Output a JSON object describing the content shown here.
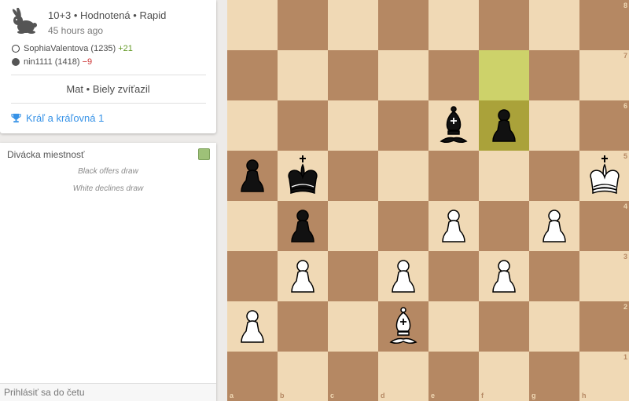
{
  "game": {
    "setup": "10+3 • Hodnotená • Rapid",
    "time_ago": "45 hours ago",
    "white_player": "SophiaValentova (1235)",
    "white_diff": "+21",
    "black_player": "nin1111 (1418)",
    "black_diff": "−9",
    "status": "Mat • Biely zvíťazil",
    "tournament": "Kráľ a kráľovná 1"
  },
  "chat": {
    "title": "Divácka miestnosť",
    "lines": [
      "Black offers draw",
      "White declines draw"
    ],
    "input_placeholder": "Prihlásiť sa do četu"
  },
  "board": {
    "files": [
      "a",
      "b",
      "c",
      "d",
      "e",
      "f",
      "g",
      "h"
    ],
    "ranks": [
      "8",
      "7",
      "6",
      "5",
      "4",
      "3",
      "2",
      "1"
    ],
    "light_color": "#f0d9b5",
    "dark_color": "#b58863",
    "highlight_squares": [
      "f7",
      "f6"
    ],
    "pieces": [
      {
        "square": "e6",
        "piece": "bishop",
        "color": "black"
      },
      {
        "square": "f6",
        "piece": "pawn",
        "color": "black"
      },
      {
        "square": "a5",
        "piece": "pawn",
        "color": "black"
      },
      {
        "square": "b5",
        "piece": "king",
        "color": "black"
      },
      {
        "square": "h5",
        "piece": "king",
        "color": "white"
      },
      {
        "square": "b4",
        "piece": "pawn",
        "color": "black"
      },
      {
        "square": "e4",
        "piece": "pawn",
        "color": "white"
      },
      {
        "square": "g4",
        "piece": "pawn",
        "color": "white"
      },
      {
        "square": "b3",
        "piece": "pawn",
        "color": "white"
      },
      {
        "square": "d3",
        "piece": "pawn",
        "color": "white"
      },
      {
        "square": "f3",
        "piece": "pawn",
        "color": "white"
      },
      {
        "square": "a2",
        "piece": "pawn",
        "color": "white"
      },
      {
        "square": "d2",
        "piece": "bishop",
        "color": "white"
      }
    ]
  }
}
